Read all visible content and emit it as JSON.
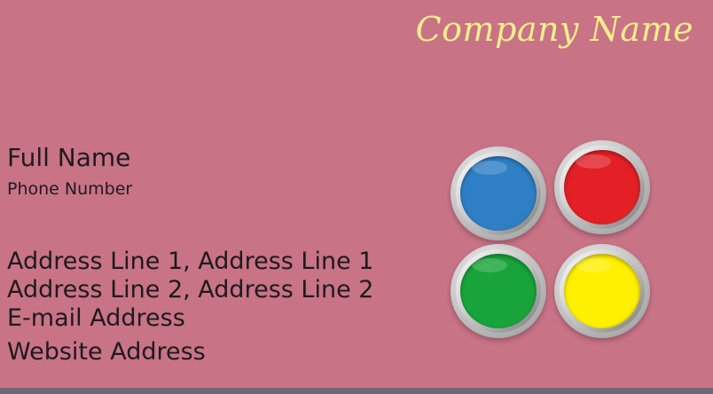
{
  "card": {
    "company_name": "Company Name",
    "full_name": "Full Name",
    "phone": "Phone Number",
    "address_line_1": "Address Line 1, Address Line 1",
    "address_line_2": "Address Line 2, Address Line 2",
    "email": "E-mail Address",
    "website": "Website Address"
  },
  "paint_cans": [
    {
      "name": "blue",
      "color": "#2f7fc6"
    },
    {
      "name": "red",
      "color": "#e32026"
    },
    {
      "name": "green",
      "color": "#18a43a"
    },
    {
      "name": "yellow",
      "color": "#ffef00"
    }
  ],
  "colors": {
    "background": "#c97387",
    "company_text": "#f3ee8c",
    "body_text": "#1d1b1c",
    "bottom_bar": "#6f667a"
  }
}
